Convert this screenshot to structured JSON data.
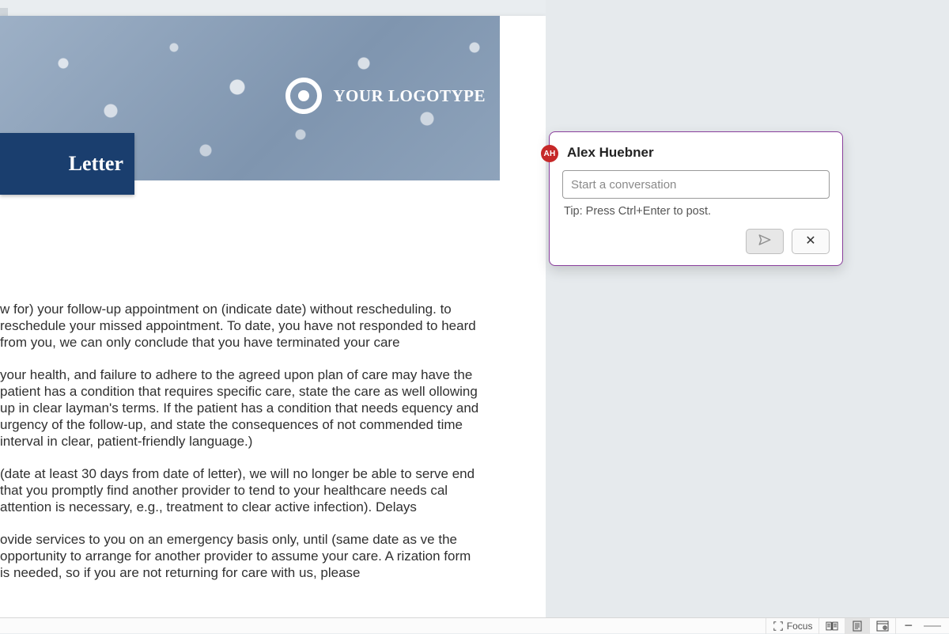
{
  "document": {
    "logotype": "YOUR LOGOTYPE",
    "title_fragment": "Letter",
    "paragraphs": [
      "w for) your follow-up appointment on (indicate date) without rescheduling. to reschedule your missed appointment. To date, you have not responded to heard from you, we can only conclude that you have terminated your care",
      "your health, and failure to adhere to the agreed upon plan of care may have the patient has a condition that requires specific care, state the care as well ollowing up in clear layman's terms. If the patient has a condition that needs equency and urgency of the follow-up, and state the consequences of not commended time interval in clear, patient-friendly language.)",
      "(date at least 30 days from date of letter), we will no longer be able to serve end that you promptly find another provider to tend to your healthcare needs cal attention is necessary, e.g., treatment to clear active infection). Delays",
      "ovide services to you on an emergency basis only, until (same date as ve the opportunity to arrange for another provider to assume your care. A rization form is needed, so if you are not returning for care with us, please"
    ]
  },
  "comment": {
    "avatar_initials": "AH",
    "author": "Alex Huebner",
    "placeholder": "Start a conversation",
    "tip": "Tip: Press Ctrl+Enter to post."
  },
  "status_bar": {
    "focus_label": "Focus"
  }
}
